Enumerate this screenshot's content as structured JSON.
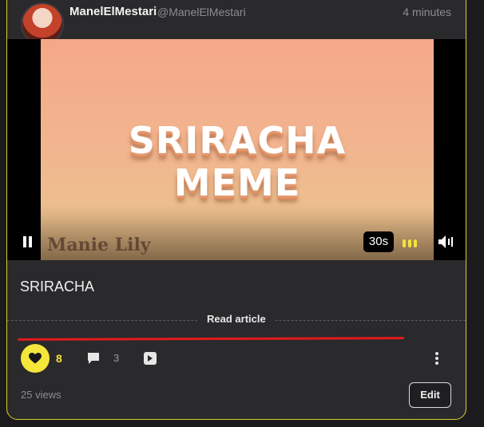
{
  "post": {
    "username": "ManelElMestari",
    "handle": "@ManelElMestari",
    "time": "4 minutes",
    "title": "SRIRACHA",
    "read_article": "Read article",
    "views": "25 views",
    "edit_label": "Edit"
  },
  "video": {
    "meme_line1": "SRIRACHA",
    "meme_line2": "MEME",
    "watermark": "Manie Lily",
    "duration": "30s"
  },
  "actions": {
    "likes": "8",
    "comments": "3"
  },
  "colors": {
    "accent": "#f4e63a",
    "card_border": "#d9cc2a",
    "progress_line": "#e31b1b",
    "background": "#1b1b1e"
  },
  "icons": [
    "avatar",
    "pause-icon",
    "bars-icon",
    "volume-icon",
    "heart-icon",
    "comment-icon",
    "share-icon",
    "more-options-icon"
  ]
}
